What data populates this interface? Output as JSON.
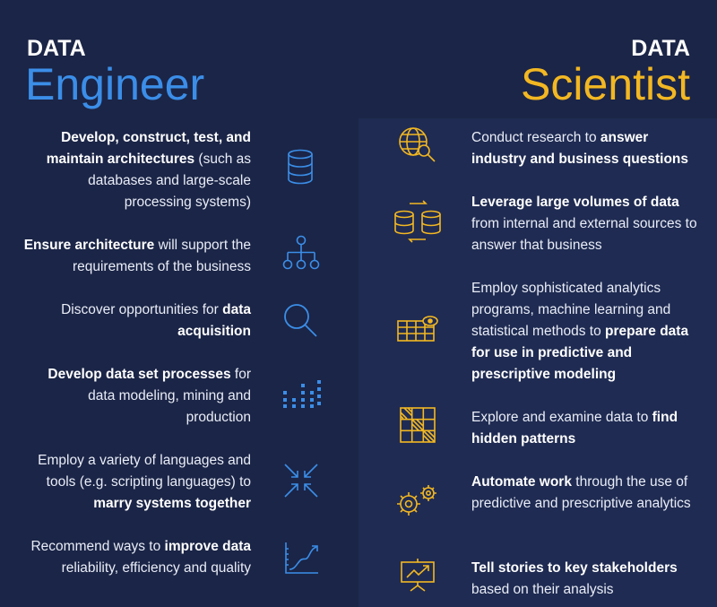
{
  "left": {
    "kicker": "DATA",
    "title": "Engineer",
    "accent": "#3b8ee8",
    "items": [
      {
        "pre": "",
        "bold": "Develop, construct, test, and maintain architectures",
        "post": " (such as databases and large-scale processing systems)",
        "icon": "database-icon"
      },
      {
        "pre": "",
        "bold": "Ensure architecture",
        "post": " will support the requirements of the business",
        "icon": "hierarchy-icon"
      },
      {
        "pre": "Discover opportunities for ",
        "bold": "data acquisition",
        "post": "",
        "icon": "search-icon"
      },
      {
        "pre": "",
        "bold": "Develop data set processes",
        "post": " for data modeling, mining and production",
        "icon": "data-grid-icon"
      },
      {
        "pre": "Employ a variety of languages and tools (e.g. scripting languages) to ",
        "bold": "marry systems together",
        "post": "",
        "icon": "converge-arrows-icon"
      },
      {
        "pre": "Recommend ways to ",
        "bold": "improve data",
        "post": " reliability, efficiency and quality",
        "icon": "line-chart-icon"
      }
    ]
  },
  "right": {
    "kicker": "DATA",
    "title": "Scientist",
    "accent": "#f2b722",
    "items": [
      {
        "pre": "Conduct research to ",
        "bold": "answer industry and business questions",
        "post": "",
        "icon": "globe-search-icon"
      },
      {
        "pre": "",
        "bold": "Leverage large volumes of data",
        "post": " from internal and external sources to answer that business",
        "icon": "database-sync-icon"
      },
      {
        "pre": "Employ sophisticated analytics programs, machine learning and statistical methods to ",
        "bold": "prepare data for use in predictive and prescriptive modeling",
        "post": "",
        "icon": "grid-eye-icon"
      },
      {
        "pre": "Explore and examine data to ",
        "bold": "find hidden patterns",
        "post": "",
        "icon": "pattern-grid-icon"
      },
      {
        "pre": "",
        "bold": "Automate work",
        "post": " through the use of predictive and prescriptive analytics",
        "icon": "gears-icon"
      },
      {
        "pre": "",
        "bold": "Tell stories to key stakeholders",
        "post": " based on their analysis",
        "icon": "presentation-icon"
      }
    ]
  }
}
